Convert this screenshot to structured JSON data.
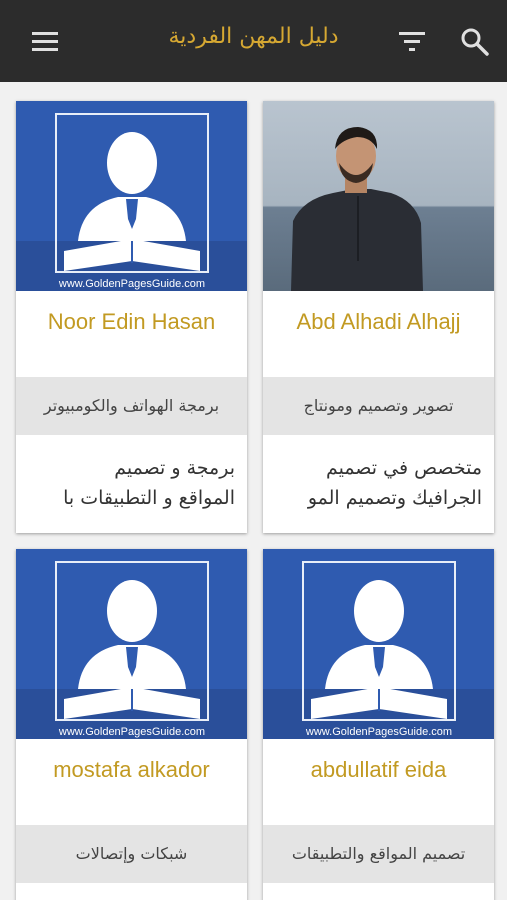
{
  "appbar": {
    "title": "دليل المهن الفردية",
    "icons": [
      "menu-icon",
      "filter-icon",
      "search-icon"
    ],
    "background": "#2c2c2c",
    "title_color": "#d6a832"
  },
  "placeholder": {
    "site_text": "www.GoldenPagesGuide.com"
  },
  "cards": [
    {
      "name": "Abd Alhadi Alhajj",
      "specialty": "تصوير وتصميم ومونتاج",
      "description_line1": "متخصص في تصميم",
      "description_line2": "الجرافيك وتصميم المو",
      "photo": "profile-photo"
    },
    {
      "name": "Noor Edin Hasan",
      "specialty": "برمجة الهواتف والكومبيوتر",
      "description_line1": "برمجة و تصميم",
      "description_line2": "المواقع و التطبيقات با",
      "photo": "placeholder-avatar"
    },
    {
      "name": "abdullatif eida",
      "specialty": "تصميم المواقع والتطبيقات",
      "description_line1": "",
      "description_line2": "",
      "photo": "placeholder-avatar"
    },
    {
      "name": "mostafa alkador",
      "specialty": "شبكات وإتصالات",
      "description_line1": "",
      "description_line2": "",
      "photo": "placeholder-avatar"
    }
  ],
  "colors": {
    "accent": "#c29a22",
    "card_band": "#e4e4e4",
    "placeholder_blue": "#2f5bb0"
  }
}
